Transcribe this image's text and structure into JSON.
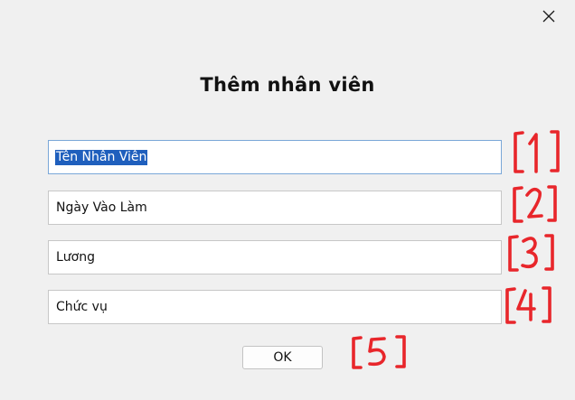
{
  "dialog": {
    "title": "Thêm nhân viên",
    "close_icon": "close-icon"
  },
  "fields": [
    {
      "value": "Tên Nhân Viên",
      "selected": true
    },
    {
      "value": "Ngày Vào Làm"
    },
    {
      "value": "Lương"
    },
    {
      "value": "Chức vụ"
    }
  ],
  "ok_button": {
    "label": "OK"
  },
  "annotations": {
    "color": "#e8262b",
    "labels": [
      "1",
      "2",
      "3",
      "4",
      "5"
    ]
  }
}
